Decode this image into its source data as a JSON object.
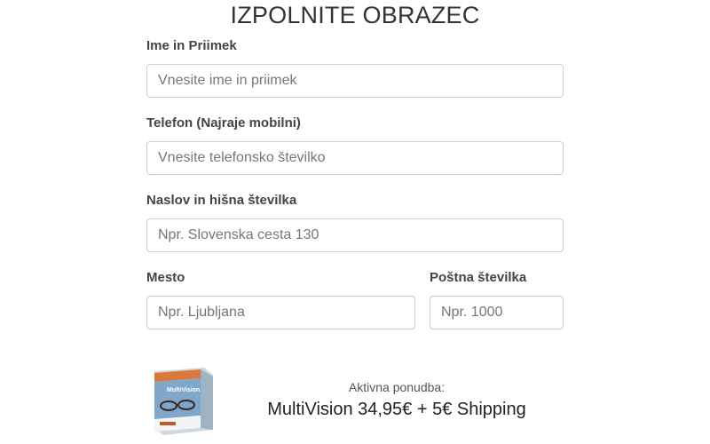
{
  "form": {
    "title": "IZPOLNITE OBRAZEC",
    "name": {
      "label": "Ime in Priimek",
      "placeholder": "Vnesite ime in priimek",
      "value": ""
    },
    "phone": {
      "label": "Telefon (Najraje mobilni)",
      "placeholder": "Vnesite telefonsko številko",
      "value": ""
    },
    "address": {
      "label": "Naslov in hišna številka",
      "placeholder": "Npr. Slovenska cesta 130",
      "value": ""
    },
    "city": {
      "label": "Mesto",
      "placeholder": "Npr. Ljubljana",
      "value": ""
    },
    "postal": {
      "label": "Poštna številka",
      "placeholder": "Npr. 1000",
      "value": ""
    }
  },
  "offer": {
    "label": "Aktivna ponudba:",
    "text": "MultiVision 34,95€ + 5€ Shipping",
    "product_brand": "MultiVision",
    "product_image_icon": "product-box-image"
  }
}
